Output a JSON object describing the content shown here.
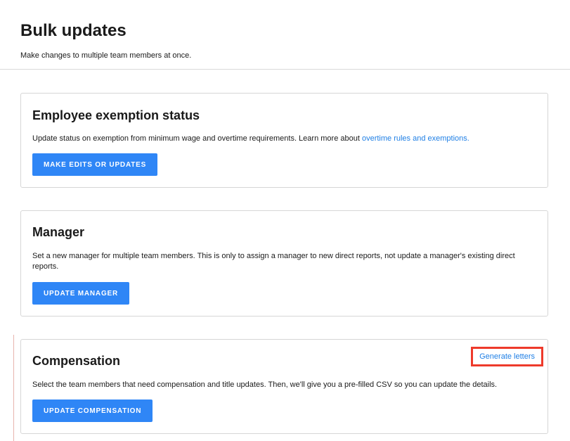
{
  "header": {
    "title": "Bulk updates",
    "subtitle": "Make changes to multiple team members at once."
  },
  "cards": {
    "exemption": {
      "title": "Employee exemption status",
      "description": "Update status on exemption from minimum wage and overtime requirements. Learn more about ",
      "link_label": "overtime rules and exemptions.",
      "button_label": "MAKE EDITS OR UPDATES"
    },
    "manager": {
      "title": "Manager",
      "description": "Set a new manager for multiple team members. This is only to assign a manager to new direct reports, not update a manager's existing direct reports.",
      "button_label": "UPDATE MANAGER"
    },
    "compensation": {
      "title": "Compensation",
      "description": "Select the team members that need compensation and title updates. Then, we'll give you a pre-filled CSV so you can update the details.",
      "button_label": "UPDATE COMPENSATION",
      "secondary_link_label": "Generate letters"
    }
  },
  "colors": {
    "primary": "#2f86f6",
    "link": "#1f7fe5",
    "highlight": "#ee3a2b",
    "border": "#d6d6d6"
  }
}
